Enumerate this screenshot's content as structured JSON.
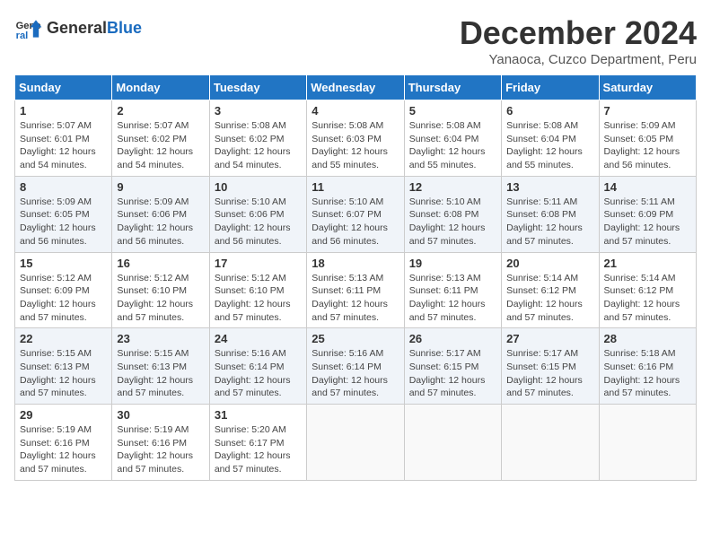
{
  "header": {
    "logo_general": "General",
    "logo_blue": "Blue",
    "month_title": "December 2024",
    "location": "Yanaoca, Cuzco Department, Peru"
  },
  "weekdays": [
    "Sunday",
    "Monday",
    "Tuesday",
    "Wednesday",
    "Thursday",
    "Friday",
    "Saturday"
  ],
  "weeks": [
    [
      {
        "day": "1",
        "sunrise": "5:07 AM",
        "sunset": "6:01 PM",
        "daylight": "12 hours and 54 minutes."
      },
      {
        "day": "2",
        "sunrise": "5:07 AM",
        "sunset": "6:02 PM",
        "daylight": "12 hours and 54 minutes."
      },
      {
        "day": "3",
        "sunrise": "5:08 AM",
        "sunset": "6:02 PM",
        "daylight": "12 hours and 54 minutes."
      },
      {
        "day": "4",
        "sunrise": "5:08 AM",
        "sunset": "6:03 PM",
        "daylight": "12 hours and 55 minutes."
      },
      {
        "day": "5",
        "sunrise": "5:08 AM",
        "sunset": "6:04 PM",
        "daylight": "12 hours and 55 minutes."
      },
      {
        "day": "6",
        "sunrise": "5:08 AM",
        "sunset": "6:04 PM",
        "daylight": "12 hours and 55 minutes."
      },
      {
        "day": "7",
        "sunrise": "5:09 AM",
        "sunset": "6:05 PM",
        "daylight": "12 hours and 56 minutes."
      }
    ],
    [
      {
        "day": "8",
        "sunrise": "5:09 AM",
        "sunset": "6:05 PM",
        "daylight": "12 hours and 56 minutes."
      },
      {
        "day": "9",
        "sunrise": "5:09 AM",
        "sunset": "6:06 PM",
        "daylight": "12 hours and 56 minutes."
      },
      {
        "day": "10",
        "sunrise": "5:10 AM",
        "sunset": "6:06 PM",
        "daylight": "12 hours and 56 minutes."
      },
      {
        "day": "11",
        "sunrise": "5:10 AM",
        "sunset": "6:07 PM",
        "daylight": "12 hours and 56 minutes."
      },
      {
        "day": "12",
        "sunrise": "5:10 AM",
        "sunset": "6:08 PM",
        "daylight": "12 hours and 57 minutes."
      },
      {
        "day": "13",
        "sunrise": "5:11 AM",
        "sunset": "6:08 PM",
        "daylight": "12 hours and 57 minutes."
      },
      {
        "day": "14",
        "sunrise": "5:11 AM",
        "sunset": "6:09 PM",
        "daylight": "12 hours and 57 minutes."
      }
    ],
    [
      {
        "day": "15",
        "sunrise": "5:12 AM",
        "sunset": "6:09 PM",
        "daylight": "12 hours and 57 minutes."
      },
      {
        "day": "16",
        "sunrise": "5:12 AM",
        "sunset": "6:10 PM",
        "daylight": "12 hours and 57 minutes."
      },
      {
        "day": "17",
        "sunrise": "5:12 AM",
        "sunset": "6:10 PM",
        "daylight": "12 hours and 57 minutes."
      },
      {
        "day": "18",
        "sunrise": "5:13 AM",
        "sunset": "6:11 PM",
        "daylight": "12 hours and 57 minutes."
      },
      {
        "day": "19",
        "sunrise": "5:13 AM",
        "sunset": "6:11 PM",
        "daylight": "12 hours and 57 minutes."
      },
      {
        "day": "20",
        "sunrise": "5:14 AM",
        "sunset": "6:12 PM",
        "daylight": "12 hours and 57 minutes."
      },
      {
        "day": "21",
        "sunrise": "5:14 AM",
        "sunset": "6:12 PM",
        "daylight": "12 hours and 57 minutes."
      }
    ],
    [
      {
        "day": "22",
        "sunrise": "5:15 AM",
        "sunset": "6:13 PM",
        "daylight": "12 hours and 57 minutes."
      },
      {
        "day": "23",
        "sunrise": "5:15 AM",
        "sunset": "6:13 PM",
        "daylight": "12 hours and 57 minutes."
      },
      {
        "day": "24",
        "sunrise": "5:16 AM",
        "sunset": "6:14 PM",
        "daylight": "12 hours and 57 minutes."
      },
      {
        "day": "25",
        "sunrise": "5:16 AM",
        "sunset": "6:14 PM",
        "daylight": "12 hours and 57 minutes."
      },
      {
        "day": "26",
        "sunrise": "5:17 AM",
        "sunset": "6:15 PM",
        "daylight": "12 hours and 57 minutes."
      },
      {
        "day": "27",
        "sunrise": "5:17 AM",
        "sunset": "6:15 PM",
        "daylight": "12 hours and 57 minutes."
      },
      {
        "day": "28",
        "sunrise": "5:18 AM",
        "sunset": "6:16 PM",
        "daylight": "12 hours and 57 minutes."
      }
    ],
    [
      {
        "day": "29",
        "sunrise": "5:19 AM",
        "sunset": "6:16 PM",
        "daylight": "12 hours and 57 minutes."
      },
      {
        "day": "30",
        "sunrise": "5:19 AM",
        "sunset": "6:16 PM",
        "daylight": "12 hours and 57 minutes."
      },
      {
        "day": "31",
        "sunrise": "5:20 AM",
        "sunset": "6:17 PM",
        "daylight": "12 hours and 57 minutes."
      },
      null,
      null,
      null,
      null
    ]
  ]
}
